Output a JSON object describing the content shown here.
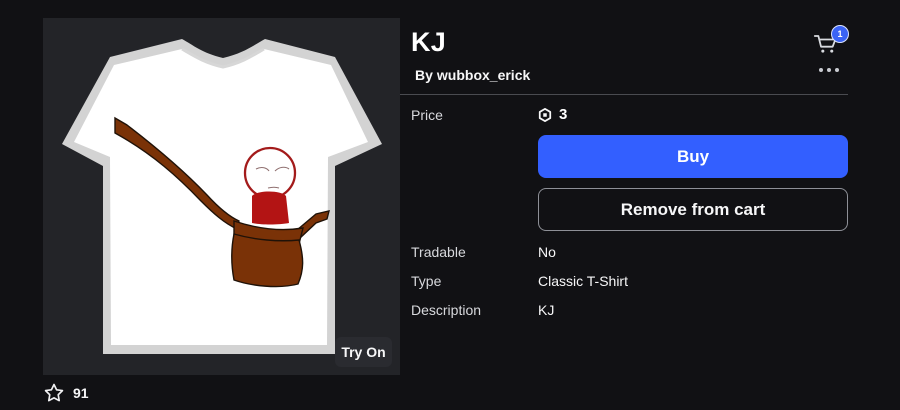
{
  "item": {
    "title": "KJ",
    "creator_prefix": "By",
    "creator_name": "wubbox_erick"
  },
  "header": {
    "cart_count": "1",
    "cart_icon": "shopping-cart-icon",
    "more_icon": "more-horizontal-icon"
  },
  "price": {
    "label": "Price",
    "icon": "robux-icon",
    "value": "3"
  },
  "actions": {
    "buy_label": "Buy",
    "remove_label": "Remove from cart",
    "try_on_label": "Try On"
  },
  "details": [
    {
      "label": "Tradable",
      "value": "No"
    },
    {
      "label": "Type",
      "value": "Classic T-Shirt"
    },
    {
      "label": "Description",
      "value": "KJ"
    }
  ],
  "stats": {
    "favorite_icon": "star-outline-icon",
    "favorites": "91"
  },
  "colors": {
    "background": "#111114",
    "image_panel": "#232428",
    "primary_button": "#335fff",
    "badge": "#3a63f5",
    "divider": "#4a4b50"
  }
}
